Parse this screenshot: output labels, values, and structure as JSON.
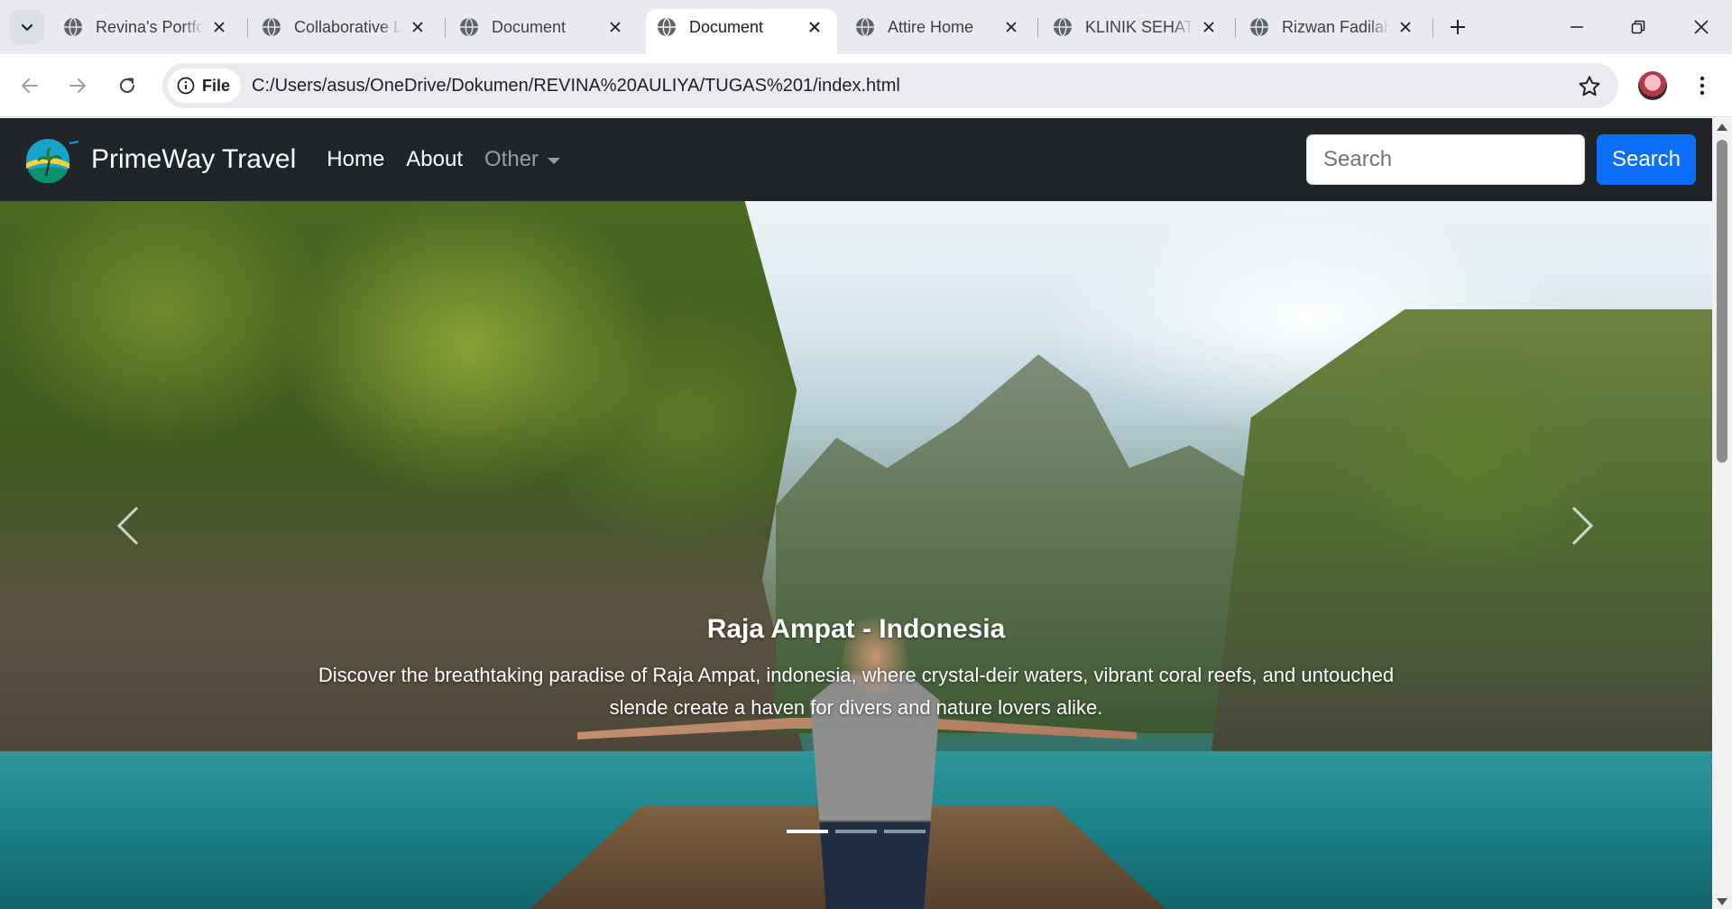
{
  "browser": {
    "tabs": [
      {
        "title": "Revina's Portfo",
        "active": false
      },
      {
        "title": "Collaborative L",
        "active": false
      },
      {
        "title": "Document",
        "active": false
      },
      {
        "title": "Document",
        "active": true
      },
      {
        "title": "Attire Home",
        "active": false
      },
      {
        "title": "KLINIK SEHAT",
        "active": false
      },
      {
        "title": "Rizwan Fadilah",
        "active": false
      }
    ],
    "address": {
      "chip_label": "File",
      "url": "C:/Users/asus/OneDrive/Dokumen/REVINA%20AULIYA/TUGAS%201/index.html"
    }
  },
  "site": {
    "brand": "PrimeWay Travel",
    "nav": {
      "home": "Home",
      "about": "About",
      "other": "Other"
    },
    "search": {
      "placeholder": "Search",
      "button": "Search"
    }
  },
  "carousel": {
    "title": "Raja Ampat - Indonesia",
    "text": "Discover the breathtaking paradise of Raja Ampat, indonesia, where crystal-deir waters, vibrant coral reefs, and untouched slende create a haven for divers and nature lovers alike.",
    "slide_count": 3,
    "active_index": 0
  },
  "colors": {
    "navbar_bg": "#212529",
    "primary": "#0d6efd",
    "tabstrip_bg": "#e8eaef"
  }
}
